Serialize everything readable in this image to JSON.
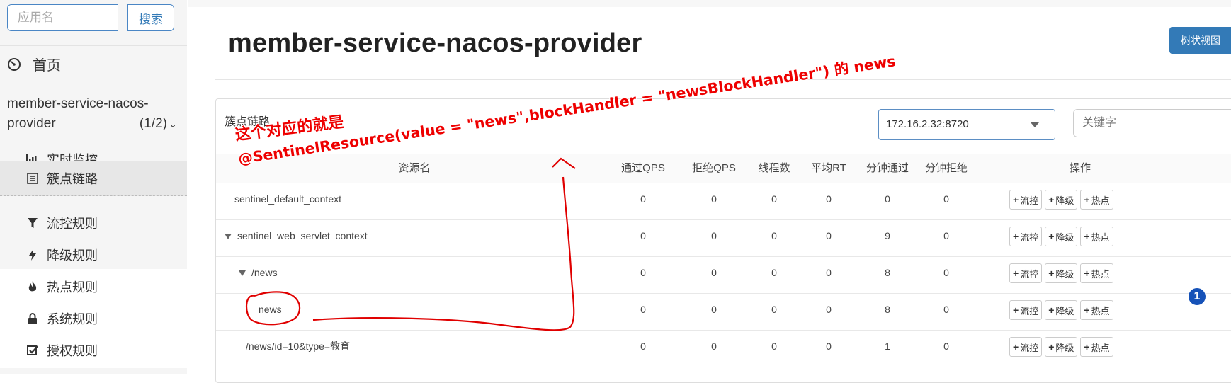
{
  "sidebar": {
    "search_placeholder": "应用名",
    "search_button": "搜索",
    "home": "首页",
    "app_name": "member-service-nacos-provider",
    "app_count": "(1/2)",
    "items": [
      {
        "label": "实时监控"
      },
      {
        "label": "簇点链路"
      },
      {
        "label": "流控规则"
      },
      {
        "label": "降级规则"
      },
      {
        "label": "热点规则"
      },
      {
        "label": "系统规则"
      },
      {
        "label": "授权规则"
      }
    ]
  },
  "main": {
    "title": "member-service-nacos-provider",
    "tree_view_button": "树状视图",
    "panel_title": "簇点链路",
    "machine": "172.16.2.32:8720",
    "keyword_placeholder": "关键字",
    "columns": [
      "资源名",
      "通过QPS",
      "拒绝QPS",
      "线程数",
      "平均RT",
      "分钟通过",
      "分钟拒绝",
      "操作"
    ],
    "rows": [
      {
        "name": "sentinel_default_context",
        "pass_qps": "0",
        "block_qps": "0",
        "threads": "0",
        "avg_rt": "0",
        "min_pass": "0",
        "min_block": "0"
      },
      {
        "name": "sentinel_web_servlet_context",
        "pass_qps": "0",
        "block_qps": "0",
        "threads": "0",
        "avg_rt": "0",
        "min_pass": "9",
        "min_block": "0"
      },
      {
        "name": "/news",
        "pass_qps": "0",
        "block_qps": "0",
        "threads": "0",
        "avg_rt": "0",
        "min_pass": "8",
        "min_block": "0"
      },
      {
        "name": "news",
        "pass_qps": "0",
        "block_qps": "0",
        "threads": "0",
        "avg_rt": "0",
        "min_pass": "8",
        "min_block": "0"
      },
      {
        "name": "/news/id=10&type=教育",
        "pass_qps": "0",
        "block_qps": "0",
        "threads": "0",
        "avg_rt": "0",
        "min_pass": "1",
        "min_block": "0"
      }
    ],
    "op_flow": "流控",
    "op_degrade": "降级",
    "op_hot": "热点"
  },
  "annotation": {
    "line1": "这个对应的就是",
    "line2": "@SentinelResource(value = \"news\",blockHandler = \"newsBlockHandler\") 的 news",
    "badge": "1",
    "color": "#e00000"
  }
}
